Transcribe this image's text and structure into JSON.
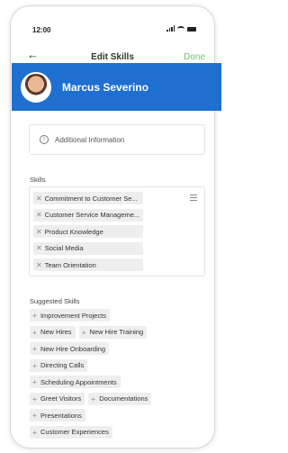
{
  "status": {
    "time": "12:00"
  },
  "nav": {
    "back_icon": "arrow-left-icon",
    "title": "Edit Skills",
    "done_label": "Done"
  },
  "profile": {
    "name": "Marcus Severino",
    "accent": "#1e6fd0"
  },
  "info": {
    "label": "Additional Information",
    "icon": "info-icon"
  },
  "skills": {
    "label": "Skills",
    "items": [
      {
        "label": "Commitment to Customer Se..."
      },
      {
        "label": "Customer Service Manageme..."
      },
      {
        "label": "Product Knowledge"
      },
      {
        "label": "Social Media"
      },
      {
        "label": "Team Orientation"
      }
    ]
  },
  "suggested": {
    "label": "Suggested Skills",
    "rows": [
      [
        "Improvement Projects"
      ],
      [
        "New Hires",
        "New Hire Training"
      ],
      [
        "New Hire Onboarding"
      ],
      [
        "Directing Calls"
      ],
      [
        "Scheduling Appointments"
      ],
      [
        "Greet Visitors",
        "Documentations"
      ],
      [
        "Presentations"
      ],
      [
        "Customer Experiences"
      ]
    ]
  },
  "colors": {
    "done": "#6cc07a",
    "chip_bg": "#eeeeee"
  }
}
